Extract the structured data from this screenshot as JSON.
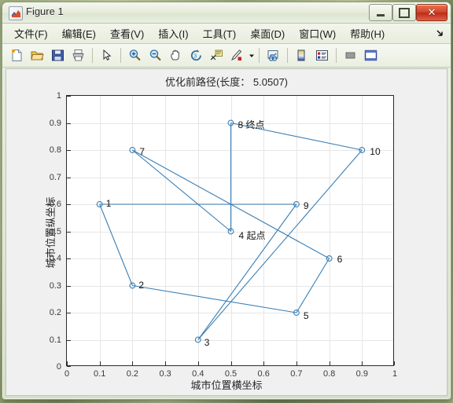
{
  "window": {
    "title": "Figure 1",
    "app_icon": "matlab-figure-icon",
    "controls": {
      "minimize": "minimize-button",
      "maximize": "maximize-button",
      "close": "✕"
    }
  },
  "menubar": {
    "items": [
      {
        "label": "文件(F)",
        "name": "menu-file"
      },
      {
        "label": "编辑(E)",
        "name": "menu-edit"
      },
      {
        "label": "查看(V)",
        "name": "menu-view"
      },
      {
        "label": "插入(I)",
        "name": "menu-insert"
      },
      {
        "label": "工具(T)",
        "name": "menu-tools"
      },
      {
        "label": "桌面(D)",
        "name": "menu-desktop"
      },
      {
        "label": "窗口(W)",
        "name": "menu-window"
      },
      {
        "label": "帮助(H)",
        "name": "menu-help"
      }
    ],
    "overflow_icon": "menu-overflow-arrow-icon"
  },
  "toolbar": {
    "items": [
      {
        "name": "new-figure-icon",
        "kind": "icon"
      },
      {
        "name": "open-file-icon",
        "kind": "icon"
      },
      {
        "name": "save-figure-icon",
        "kind": "icon"
      },
      {
        "name": "print-figure-icon",
        "kind": "icon"
      },
      {
        "name": "toolbar-separator-1",
        "kind": "sep"
      },
      {
        "name": "pointer-select-icon",
        "kind": "icon"
      },
      {
        "name": "toolbar-separator-2",
        "kind": "sep"
      },
      {
        "name": "zoom-in-icon",
        "kind": "icon"
      },
      {
        "name": "zoom-out-icon",
        "kind": "icon"
      },
      {
        "name": "pan-hand-icon",
        "kind": "icon"
      },
      {
        "name": "rotate-3d-icon",
        "kind": "icon"
      },
      {
        "name": "data-cursor-icon",
        "kind": "icon"
      },
      {
        "name": "brush-data-icon",
        "kind": "icon"
      },
      {
        "name": "brush-dropdown-caret-icon",
        "kind": "caret"
      },
      {
        "name": "toolbar-separator-3",
        "kind": "sep"
      },
      {
        "name": "link-plot-icon",
        "kind": "icon"
      },
      {
        "name": "toolbar-separator-4",
        "kind": "sep"
      },
      {
        "name": "colorbar-icon",
        "kind": "icon"
      },
      {
        "name": "legend-icon",
        "kind": "icon"
      },
      {
        "name": "toolbar-separator-5",
        "kind": "sep"
      },
      {
        "name": "hide-plot-tools-icon",
        "kind": "icon"
      },
      {
        "name": "show-plot-tools-icon",
        "kind": "icon"
      }
    ]
  },
  "chart_data": {
    "type": "scatter",
    "title": "优化前路径(长度： 5.0507)",
    "xlabel": "城市位置横坐标",
    "ylabel": "城市位置纵坐标",
    "xlim": [
      0,
      1
    ],
    "ylim": [
      0,
      1
    ],
    "xticks": [
      "0",
      "0.1",
      "0.2",
      "0.3",
      "0.4",
      "0.5",
      "0.6",
      "0.7",
      "0.8",
      "0.9",
      "1"
    ],
    "yticks": [
      "0",
      "0.1",
      "0.2",
      "0.3",
      "0.4",
      "0.5",
      "0.6",
      "0.7",
      "0.8",
      "0.9",
      "1"
    ],
    "grid": true,
    "legend": null,
    "route_length": "5.0507",
    "line_color": "#3a7fb5",
    "marker": "circle-open",
    "points": [
      {
        "id": "1",
        "label": "1",
        "x": 0.1,
        "y": 0.6,
        "label_dx": 8,
        "label_dy": -1
      },
      {
        "id": "2",
        "label": "2",
        "x": 0.2,
        "y": 0.3,
        "label_dx": 8,
        "label_dy": -1
      },
      {
        "id": "3",
        "label": "3",
        "x": 0.4,
        "y": 0.1,
        "label_dx": 8,
        "label_dy": 3
      },
      {
        "id": "4",
        "label": "4  起点",
        "x": 0.5,
        "y": 0.5,
        "label_dx": 10,
        "label_dy": 3
      },
      {
        "id": "5",
        "label": "5",
        "x": 0.7,
        "y": 0.2,
        "label_dx": 9,
        "label_dy": 4
      },
      {
        "id": "6",
        "label": "6",
        "x": 0.8,
        "y": 0.4,
        "label_dx": 10,
        "label_dy": 1
      },
      {
        "id": "7",
        "label": "7",
        "x": 0.2,
        "y": 0.8,
        "label_dx": 9,
        "label_dy": 2
      },
      {
        "id": "8",
        "label": "8  终点",
        "x": 0.5,
        "y": 0.9,
        "label_dx": 9,
        "label_dy": 0
      },
      {
        "id": "9",
        "label": "9",
        "x": 0.7,
        "y": 0.6,
        "label_dx": 9,
        "label_dy": 2
      },
      {
        "id": "10",
        "label": "10",
        "x": 0.9,
        "y": 0.8,
        "label_dx": 10,
        "label_dy": 2
      }
    ],
    "route_order": [
      "4",
      "8",
      "10",
      "3",
      "9",
      "1",
      "2",
      "5",
      "6",
      "7",
      "4"
    ],
    "edges": [
      {
        "from": "4",
        "to": "8"
      },
      {
        "from": "8",
        "to": "10"
      },
      {
        "from": "10",
        "to": "3"
      },
      {
        "from": "3",
        "to": "9"
      },
      {
        "from": "9",
        "to": "1"
      },
      {
        "from": "1",
        "to": "2"
      },
      {
        "from": "2",
        "to": "5"
      },
      {
        "from": "5",
        "to": "6"
      },
      {
        "from": "6",
        "to": "7"
      },
      {
        "from": "7",
        "to": "4"
      }
    ],
    "start_point": "4",
    "end_point": "8",
    "start_annotation": "起点",
    "end_annotation": "终点"
  }
}
